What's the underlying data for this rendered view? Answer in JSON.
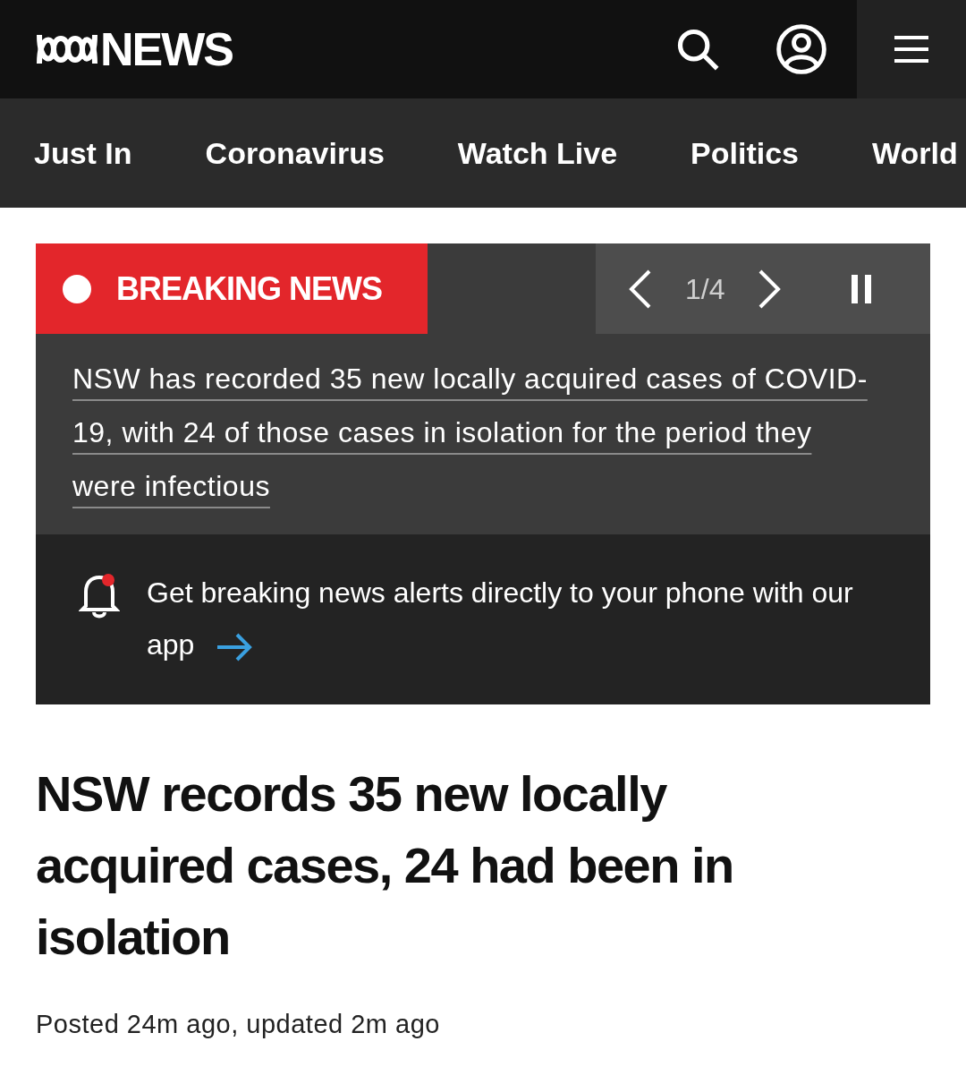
{
  "header": {
    "brand": "NEWS"
  },
  "nav": {
    "items": [
      "Just In",
      "Coronavirus",
      "Watch Live",
      "Politics",
      "World"
    ]
  },
  "breaking": {
    "label": "BREAKING NEWS",
    "counter": "1/4",
    "headline": "NSW has recorded 35 new locally acquired cases of COVID-19, with 24 of those cases in isolation for the period they were infectious",
    "alert": "Get breaking news alerts directly to your phone with our app"
  },
  "article": {
    "title": "NSW records 35 new locally acquired cases, 24 had been in isolation",
    "meta": "Posted 24m ago, updated 2m ago"
  }
}
